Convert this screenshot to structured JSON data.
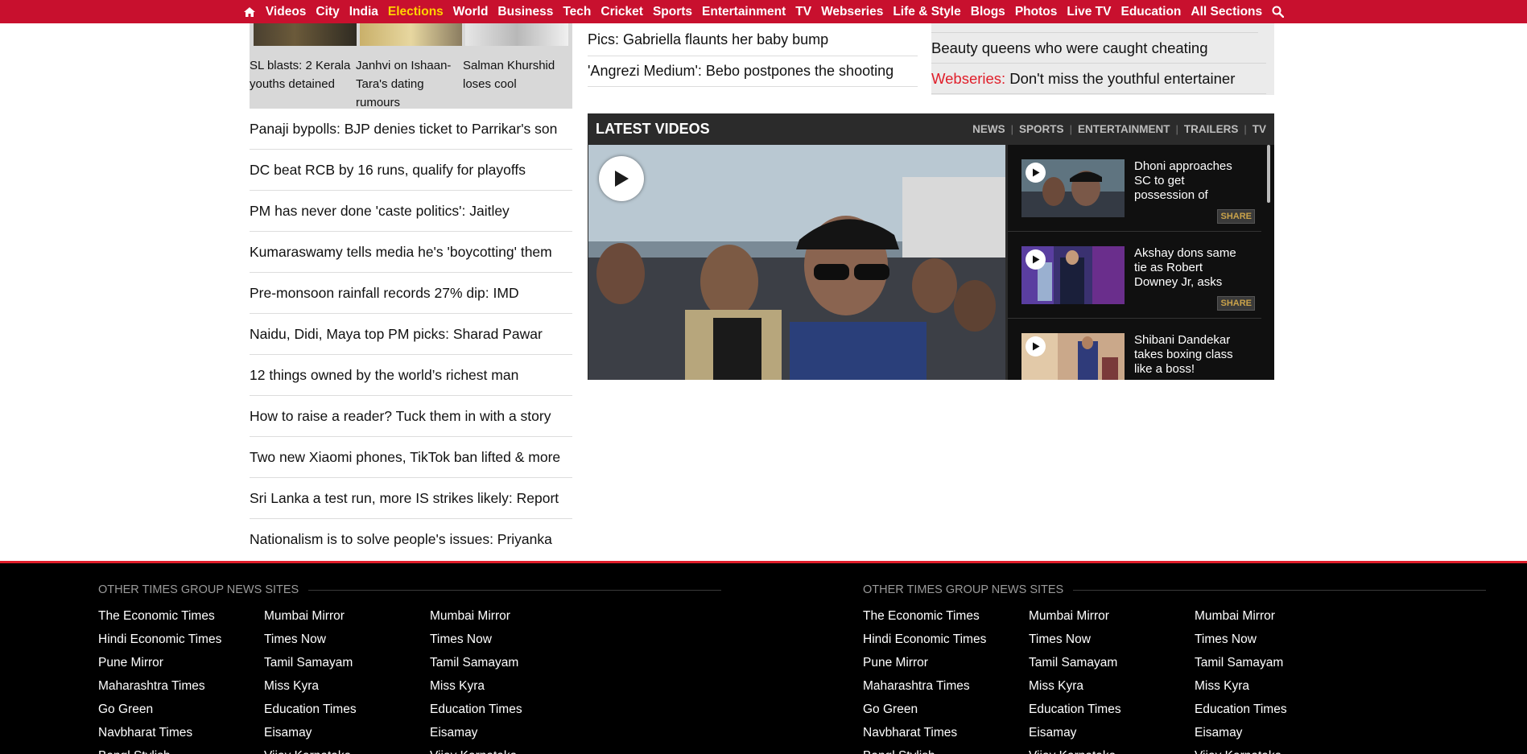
{
  "nav": {
    "items": [
      {
        "label": "Videos"
      },
      {
        "label": "City"
      },
      {
        "label": "India"
      },
      {
        "label": "Elections",
        "highlight": true
      },
      {
        "label": "World"
      },
      {
        "label": "Business"
      },
      {
        "label": "Tech"
      },
      {
        "label": "Cricket"
      },
      {
        "label": "Sports"
      },
      {
        "label": "Entertainment"
      },
      {
        "label": "TV"
      },
      {
        "label": "Webseries"
      },
      {
        "label": "Life & Style"
      },
      {
        "label": "Blogs"
      },
      {
        "label": "Photos"
      },
      {
        "label": "Live TV"
      },
      {
        "label": "Education"
      },
      {
        "label": "All Sections"
      }
    ],
    "bg_color": "#c8102e",
    "highlight_color": "#ffd200"
  },
  "left": {
    "captions": [
      "SL blasts: 2 Kerala youths detained",
      "Janhvi on Ishaan-Tara's dating rumours",
      "Salman Khurshid loses cool"
    ],
    "headlines": [
      "Panaji bypolls: BJP denies ticket to Parrikar's son",
      "DC beat RCB by 16 runs, qualify for playoffs",
      "PM has never done 'caste politics': Jaitley",
      "Kumaraswamy tells media he's 'boycotting' them",
      "Pre-monsoon rainfall records 27% dip: IMD",
      "Naidu, Didi, Maya top PM picks: Sharad Pawar",
      "12 things owned by the world’s richest man",
      "How to raise a reader? Tuck them in with a story",
      "Two new Xiaomi phones, TikTok ban lifted & more",
      "Sri Lanka a test run, more IS strikes likely: Report",
      "Nationalism is to solve people's issues: Priyanka"
    ]
  },
  "middle": {
    "links": [
      "Pics: Gabriella flaunts her baby bump",
      "'Angrezi Medium': Bebo postpones the shooting"
    ]
  },
  "right": {
    "links": [
      {
        "tag": "",
        "text": "Beauty queens who were caught cheating"
      },
      {
        "tag": "Webseries:",
        "text": "Don't miss the youthful entertainer"
      }
    ]
  },
  "videos": {
    "title": "LATEST VIDEOS",
    "tabs": [
      "NEWS",
      "SPORTS",
      "ENTERTAINMENT",
      "TRAILERS",
      "TV"
    ],
    "items": [
      {
        "title": "Dhoni approaches SC to get possession of",
        "share": "SHARE"
      },
      {
        "title": "Akshay dons same tie as Robert Downey Jr, asks",
        "share": "SHARE"
      },
      {
        "title": "Shibani Dandekar takes boxing class like a boss!",
        "share": ""
      }
    ]
  },
  "footer": {
    "heading": "OTHER TIMES GROUP NEWS SITES",
    "columns": [
      [
        "The Economic Times",
        "Hindi Economic Times",
        "Pune Mirror",
        "Maharashtra Times",
        "Go Green",
        "Navbharat Times",
        "Bangl Stylish"
      ],
      [
        "Mumbai Mirror",
        "Times Now",
        "Tamil Samayam",
        "Miss Kyra",
        "Education Times",
        "Eisamay",
        "Vijay Karnataka"
      ],
      [
        "Mumbai Mirror",
        "Times Now",
        "Tamil Samayam",
        "Miss Kyra",
        "Education Times",
        "Eisamay",
        "Vijay Karnataka"
      ]
    ],
    "accent": "#e01e2a"
  }
}
